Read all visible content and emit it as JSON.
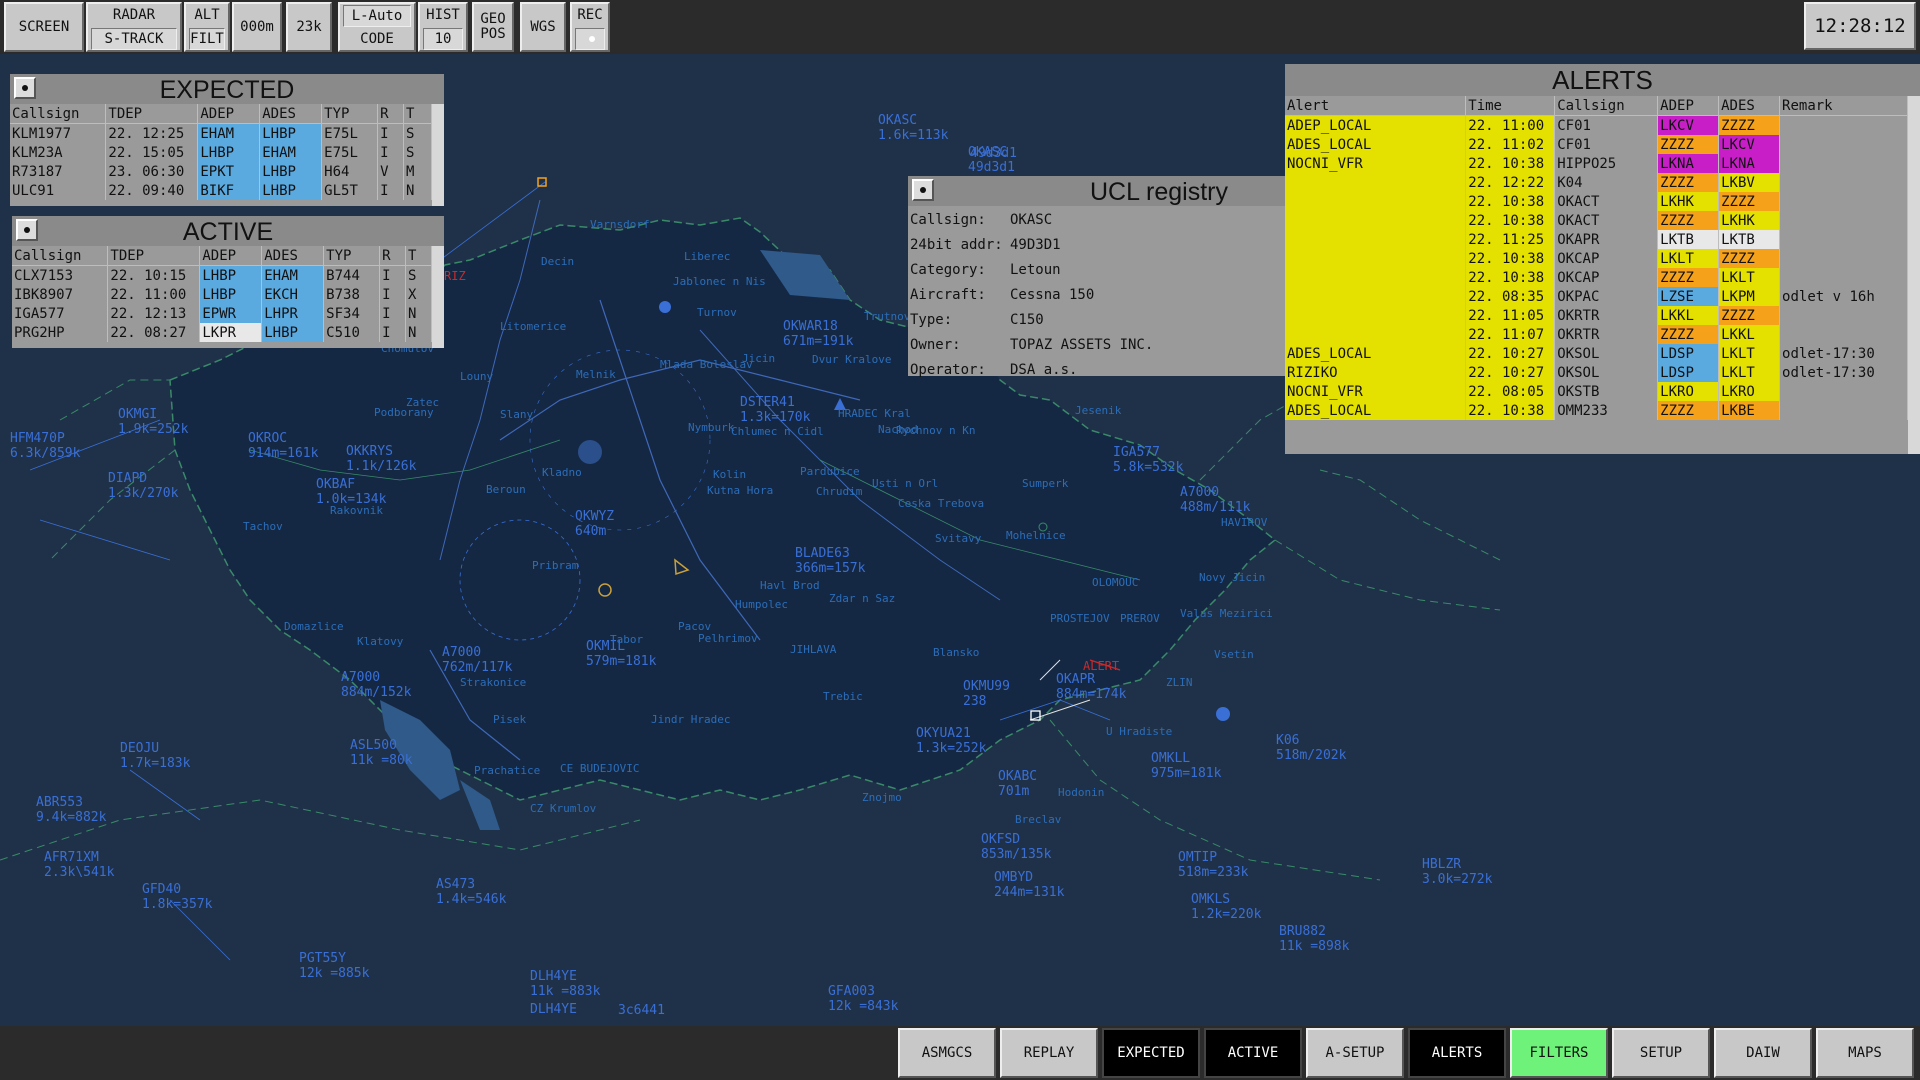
{
  "toolbar": {
    "screen": "SCREEN",
    "radar": "RADAR",
    "strack": "S-TRACK",
    "alt": "ALT",
    "filt": "FILT",
    "alt_value": "000m",
    "alt_23k": "23k",
    "lauto": "L-Auto",
    "code": "CODE",
    "hist": "HIST",
    "hist_value": "10",
    "geo": "GEO",
    "pos": "POS",
    "wgs": "WGS",
    "rec": "REC",
    "clock": "12:28:12"
  },
  "expected": {
    "title": "EXPECTED",
    "headers": [
      "Callsign",
      "TDEP",
      "ADEP",
      "ADES",
      "TYP",
      "R",
      "T"
    ],
    "rows": [
      {
        "callsign": "KLM1977",
        "tdep": "22. 12:25",
        "adep": "EHAM",
        "ades": "LHBP",
        "typ": "E75L",
        "r": "I",
        "t": "S"
      },
      {
        "callsign": "KLM23A",
        "tdep": "22. 15:05",
        "adep": "LHBP",
        "ades": "EHAM",
        "typ": "E75L",
        "r": "I",
        "t": "S"
      },
      {
        "callsign": "R73187",
        "tdep": "23. 06:30",
        "adep": "EPKT",
        "ades": "LHBP",
        "typ": "H64",
        "r": "V",
        "t": "M"
      },
      {
        "callsign": "ULC91",
        "tdep": "22. 09:40",
        "adep": "BIKF",
        "ades": "LHBP",
        "typ": "GL5T",
        "r": "I",
        "t": "N"
      }
    ]
  },
  "active": {
    "title": "ACTIVE",
    "headers": [
      "Callsign",
      "TDEP",
      "ADEP",
      "ADES",
      "TYP",
      "R",
      "T"
    ],
    "rows": [
      {
        "callsign": "CLX7153",
        "tdep": "22. 10:15",
        "adep": "LHBP",
        "ades": "EHAM",
        "typ": "B744",
        "r": "I",
        "t": "S"
      },
      {
        "callsign": "IBK8907",
        "tdep": "22. 11:00",
        "adep": "LHBP",
        "ades": "EKCH",
        "typ": "B738",
        "r": "I",
        "t": "X"
      },
      {
        "callsign": "IGA577",
        "tdep": "22. 12:13",
        "adep": "EPWR",
        "ades": "LHPR",
        "typ": "SF34",
        "r": "I",
        "t": "N"
      },
      {
        "callsign": "PRG2HP",
        "tdep": "22. 08:27",
        "adep": "LKPR",
        "ades": "LHBP",
        "typ": "C510",
        "r": "I",
        "t": "N"
      }
    ]
  },
  "ucl": {
    "title": "UCL registry",
    "fields": [
      {
        "label": "Callsign:",
        "value": "OKASC"
      },
      {
        "label": "24bit addr:",
        "value": "49D3D1"
      },
      {
        "label": "Category:",
        "value": "Letoun"
      },
      {
        "label": "Aircraft:",
        "value": "Cessna 150"
      },
      {
        "label": "Type:",
        "value": "C150"
      },
      {
        "label": "Owner:",
        "value": "TOPAZ ASSETS INC."
      },
      {
        "label": "Operator:",
        "value": "DSA a.s."
      }
    ]
  },
  "alerts": {
    "title": "ALERTS",
    "headers": [
      "Alert",
      "Time",
      "Callsign",
      "ADEP",
      "ADES",
      "Remark"
    ],
    "rows": [
      {
        "alert": "ADEP_LOCAL",
        "time": "22. 11:00",
        "callsign": "CF01",
        "adep": "LKCV",
        "ades": "ZZZZ",
        "remark": "",
        "adep_c": "cm",
        "ades_c": "co"
      },
      {
        "alert": "ADES_LOCAL",
        "time": "22. 11:02",
        "callsign": "CF01",
        "adep": "ZZZZ",
        "ades": "LKCV",
        "remark": "",
        "adep_c": "co",
        "ades_c": "cm"
      },
      {
        "alert": "NOCNI_VFR",
        "time": "22. 10:38",
        "callsign": "HIPPO25",
        "adep": "LKNA",
        "ades": "LKNA",
        "remark": "",
        "adep_c": "cm",
        "ades_c": "cm"
      },
      {
        "alert": "",
        "time": "22. 12:22",
        "callsign": "K04",
        "adep": "ZZZZ",
        "ades": "LKBV",
        "remark": "",
        "adep_c": "co",
        "ades_c": "cy"
      },
      {
        "alert": "",
        "time": "22. 10:38",
        "callsign": "OKACT",
        "adep": "LKHK",
        "ades": "ZZZZ",
        "remark": "",
        "adep_c": "cy",
        "ades_c": "co"
      },
      {
        "alert": "",
        "time": "22. 10:38",
        "callsign": "OKACT",
        "adep": "ZZZZ",
        "ades": "LKHK",
        "remark": "",
        "adep_c": "co",
        "ades_c": "cy"
      },
      {
        "alert": "",
        "time": "22. 11:25",
        "callsign": "OKAPR",
        "adep": "LKTB",
        "ades": "LKTB",
        "remark": "",
        "adep_c": "cw",
        "ades_c": "cw"
      },
      {
        "alert": "",
        "time": "22. 10:38",
        "callsign": "OKCAP",
        "adep": "LKLT",
        "ades": "ZZZZ",
        "remark": "",
        "adep_c": "cy",
        "ades_c": "co"
      },
      {
        "alert": "",
        "time": "22. 10:38",
        "callsign": "OKCAP",
        "adep": "ZZZZ",
        "ades": "LKLT",
        "remark": "",
        "adep_c": "co",
        "ades_c": "cy"
      },
      {
        "alert": "",
        "time": "22. 08:35",
        "callsign": "OKPAC",
        "adep": "LZSE",
        "ades": "LKPM",
        "remark": "odlet v 16h",
        "adep_c": "cb",
        "ades_c": "cy"
      },
      {
        "alert": "",
        "time": "22. 11:05",
        "callsign": "OKRTR",
        "adep": "LKKL",
        "ades": "ZZZZ",
        "remark": "",
        "adep_c": "cy",
        "ades_c": "co"
      },
      {
        "alert": "",
        "time": "22. 11:07",
        "callsign": "OKRTR",
        "adep": "ZZZZ",
        "ades": "LKKL",
        "remark": "",
        "adep_c": "co",
        "ades_c": "cy"
      },
      {
        "alert": "ADES_LOCAL",
        "time": "22. 10:27",
        "callsign": "OKSOL",
        "adep": "LDSP",
        "ades": "LKLT",
        "remark": "odlet-17:30",
        "adep_c": "cb",
        "ades_c": "cy"
      },
      {
        "alert": "RIZIKO",
        "time": "22. 10:27",
        "callsign": "OKSOL",
        "adep": "LDSP",
        "ades": "LKLT",
        "remark": "odlet-17:30",
        "adep_c": "cb",
        "ades_c": "cy"
      },
      {
        "alert": "NOCNI_VFR",
        "time": "22. 08:05",
        "callsign": "OKSTB",
        "adep": "LKRO",
        "ades": "LKRO",
        "remark": "",
        "adep_c": "cy",
        "ades_c": "cy"
      },
      {
        "alert": "ADES_LOCAL",
        "time": "22. 10:38",
        "callsign": "OMM233",
        "adep": "ZZZZ",
        "ades": "LKBE",
        "remark": "",
        "adep_c": "co",
        "ades_c": "co"
      }
    ]
  },
  "bottom": {
    "asmgcs": "ASMGCS",
    "replay": "REPLAY",
    "expected": "EXPECTED",
    "active": "ACTIVE",
    "asetup": "A-SETUP",
    "alerts": "ALERTS",
    "filters": "FILTERS",
    "setup": "SETUP",
    "daiw": "DAIW",
    "maps": "MAPS"
  },
  "map": {
    "tracks": [
      {
        "line1": "OKASC",
        "line2": "1.6k=113k"
      },
      {
        "line1": "OKASC",
        "line2": "49d3d1"
      },
      {
        "line1": "HFM470P",
        "line2": "6.3k/859k"
      },
      {
        "line1": "OKMGI",
        "line2": "1.9k=252k"
      },
      {
        "line1": "DIAPD",
        "line2": "1.3k/270k"
      },
      {
        "line1": "OKBAF",
        "line2": "1.0k=134k"
      },
      {
        "line1": "OKROC",
        "line2": "914m=161k"
      },
      {
        "line1": "OKKRYS",
        "line2": "1.1k/126k"
      },
      {
        "line1": "DSTER41",
        "line2": "1.3k=170k"
      },
      {
        "line1": "OKWAR18",
        "line2": "671m=191k"
      },
      {
        "line1": "BLADE63",
        "line2": "366m=157k"
      },
      {
        "line1": "IGA577",
        "line2": "5.8k=532k"
      },
      {
        "line1": "A7000",
        "line2": "488m/111k"
      },
      {
        "line1": "OKAPR",
        "line2": "884m=174k"
      },
      {
        "line1": "OKYUA21",
        "line2": "1.3k=252k"
      },
      {
        "line1": "OMKLL",
        "line2": "975m=181k"
      },
      {
        "line1": "K06",
        "line2": "518m/202k"
      },
      {
        "line1": "DEOJU",
        "line2": "1.7k=183k"
      },
      {
        "line1": "ABR553",
        "line2": "9.4k=882k"
      },
      {
        "line1": "AFR71XM",
        "line2": "2.3k\\541k"
      },
      {
        "line1": "GFD40",
        "line2": "1.8k=357k"
      },
      {
        "line1": "ASL500",
        "line2": "11k =80k"
      },
      {
        "line1": "A7000",
        "line2": "884m/152k"
      },
      {
        "line1": "A7000",
        "line2": "762m/117k"
      },
      {
        "line1": "OKMIL",
        "line2": "579m=181k"
      },
      {
        "line1": "AS473",
        "line2": "1.4k=546k"
      },
      {
        "line1": "OKFSD",
        "line2": "853m/135k"
      },
      {
        "line1": "OMBYD",
        "line2": "244m=131k"
      },
      {
        "line1": "OMTIP",
        "line2": "518m=233k"
      },
      {
        "line1": "OMKLS",
        "line2": "1.2k=220k"
      },
      {
        "line1": "BRU882",
        "line2": "11k =898k"
      },
      {
        "line1": "HBLZR",
        "line2": "3.0k=272k"
      },
      {
        "line1": "PGT55Y",
        "line2": "12k =885k"
      },
      {
        "line1": "DLH4YE",
        "line2": "11k =883k"
      },
      {
        "line1": "GFA003",
        "line2": "12k =843k"
      },
      {
        "line1": "OKWYZ",
        "line2": "640m"
      },
      {
        "line1": "OKABC",
        "line2": "701m"
      },
      {
        "line1": "OKMU99",
        "line2": "238"
      }
    ],
    "places": [
      "Varnsdorf",
      "Decin",
      "Liberec",
      "Jablonec n Nis",
      "Trutnov",
      "Turnov",
      "Dvur Kralove",
      "Jicin",
      "Mlada Boleslav",
      "Melnik",
      "Litomerice",
      "Louny",
      "Podborany",
      "Zatec",
      "Slany",
      "Kladno",
      "Beroun",
      "Pribram",
      "Tachov",
      "Domazlice",
      "Klatovy",
      "Strakonice",
      "Pisek",
      "Prachatice",
      "CE BUDEJOVIC",
      "CZ Krumlov",
      "Tabor",
      "Pelhrimov",
      "JIHLAVA",
      "Jindr Hradec",
      "Trebic",
      "Znojmo",
      "Breclav",
      "Kolin",
      "Kutna Hora",
      "Chrudim",
      "Pardubice",
      "HRADEC Kral",
      "Nachod",
      "Rychnov n Kn",
      "Jesenik",
      "Sumperk",
      "Svitavy",
      "Mohelnice",
      "OLOMOUC",
      "PROSTEJOV",
      "PREROV",
      "Novy Jicin",
      "Valas Mezirici",
      "Vsetin",
      "ZLIN",
      "U Hradiste",
      "Humpolec",
      "Havl Brod",
      "Zdar n Saz",
      "Blansko",
      "Hodonin",
      "Chomutov",
      "Nymburk",
      "Chlumec n Cidl",
      "Pacov",
      "HAVIROV",
      "Usti n Orl",
      "Ceska Trebova",
      "Rakovnik"
    ],
    "misc": [
      "3c6441",
      "49d3d1",
      "DLH4YE"
    ]
  }
}
